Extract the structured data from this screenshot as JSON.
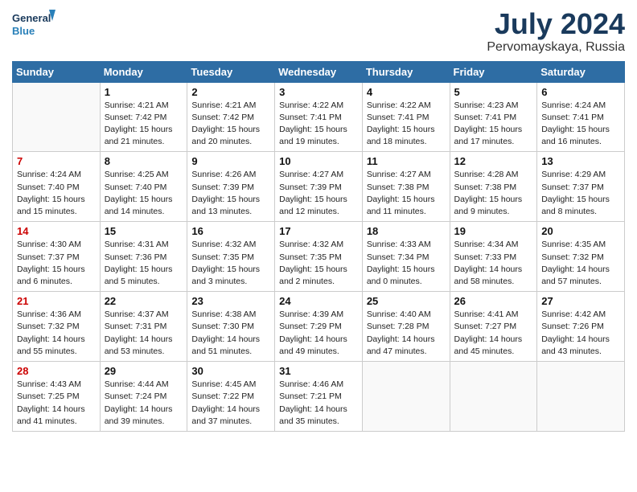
{
  "header": {
    "logo_line1": "General",
    "logo_line2": "Blue",
    "month_year": "July 2024",
    "location": "Pervomayskaya, Russia"
  },
  "days_of_week": [
    "Sunday",
    "Monday",
    "Tuesday",
    "Wednesday",
    "Thursday",
    "Friday",
    "Saturday"
  ],
  "weeks": [
    [
      {
        "day": "",
        "info": ""
      },
      {
        "day": "1",
        "info": "Sunrise: 4:21 AM\nSunset: 7:42 PM\nDaylight: 15 hours\nand 21 minutes."
      },
      {
        "day": "2",
        "info": "Sunrise: 4:21 AM\nSunset: 7:42 PM\nDaylight: 15 hours\nand 20 minutes."
      },
      {
        "day": "3",
        "info": "Sunrise: 4:22 AM\nSunset: 7:41 PM\nDaylight: 15 hours\nand 19 minutes."
      },
      {
        "day": "4",
        "info": "Sunrise: 4:22 AM\nSunset: 7:41 PM\nDaylight: 15 hours\nand 18 minutes."
      },
      {
        "day": "5",
        "info": "Sunrise: 4:23 AM\nSunset: 7:41 PM\nDaylight: 15 hours\nand 17 minutes."
      },
      {
        "day": "6",
        "info": "Sunrise: 4:24 AM\nSunset: 7:41 PM\nDaylight: 15 hours\nand 16 minutes."
      }
    ],
    [
      {
        "day": "7",
        "info": "Sunrise: 4:24 AM\nSunset: 7:40 PM\nDaylight: 15 hours\nand 15 minutes."
      },
      {
        "day": "8",
        "info": "Sunrise: 4:25 AM\nSunset: 7:40 PM\nDaylight: 15 hours\nand 14 minutes."
      },
      {
        "day": "9",
        "info": "Sunrise: 4:26 AM\nSunset: 7:39 PM\nDaylight: 15 hours\nand 13 minutes."
      },
      {
        "day": "10",
        "info": "Sunrise: 4:27 AM\nSunset: 7:39 PM\nDaylight: 15 hours\nand 12 minutes."
      },
      {
        "day": "11",
        "info": "Sunrise: 4:27 AM\nSunset: 7:38 PM\nDaylight: 15 hours\nand 11 minutes."
      },
      {
        "day": "12",
        "info": "Sunrise: 4:28 AM\nSunset: 7:38 PM\nDaylight: 15 hours\nand 9 minutes."
      },
      {
        "day": "13",
        "info": "Sunrise: 4:29 AM\nSunset: 7:37 PM\nDaylight: 15 hours\nand 8 minutes."
      }
    ],
    [
      {
        "day": "14",
        "info": "Sunrise: 4:30 AM\nSunset: 7:37 PM\nDaylight: 15 hours\nand 6 minutes."
      },
      {
        "day": "15",
        "info": "Sunrise: 4:31 AM\nSunset: 7:36 PM\nDaylight: 15 hours\nand 5 minutes."
      },
      {
        "day": "16",
        "info": "Sunrise: 4:32 AM\nSunset: 7:35 PM\nDaylight: 15 hours\nand 3 minutes."
      },
      {
        "day": "17",
        "info": "Sunrise: 4:32 AM\nSunset: 7:35 PM\nDaylight: 15 hours\nand 2 minutes."
      },
      {
        "day": "18",
        "info": "Sunrise: 4:33 AM\nSunset: 7:34 PM\nDaylight: 15 hours\nand 0 minutes."
      },
      {
        "day": "19",
        "info": "Sunrise: 4:34 AM\nSunset: 7:33 PM\nDaylight: 14 hours\nand 58 minutes."
      },
      {
        "day": "20",
        "info": "Sunrise: 4:35 AM\nSunset: 7:32 PM\nDaylight: 14 hours\nand 57 minutes."
      }
    ],
    [
      {
        "day": "21",
        "info": "Sunrise: 4:36 AM\nSunset: 7:32 PM\nDaylight: 14 hours\nand 55 minutes."
      },
      {
        "day": "22",
        "info": "Sunrise: 4:37 AM\nSunset: 7:31 PM\nDaylight: 14 hours\nand 53 minutes."
      },
      {
        "day": "23",
        "info": "Sunrise: 4:38 AM\nSunset: 7:30 PM\nDaylight: 14 hours\nand 51 minutes."
      },
      {
        "day": "24",
        "info": "Sunrise: 4:39 AM\nSunset: 7:29 PM\nDaylight: 14 hours\nand 49 minutes."
      },
      {
        "day": "25",
        "info": "Sunrise: 4:40 AM\nSunset: 7:28 PM\nDaylight: 14 hours\nand 47 minutes."
      },
      {
        "day": "26",
        "info": "Sunrise: 4:41 AM\nSunset: 7:27 PM\nDaylight: 14 hours\nand 45 minutes."
      },
      {
        "day": "27",
        "info": "Sunrise: 4:42 AM\nSunset: 7:26 PM\nDaylight: 14 hours\nand 43 minutes."
      }
    ],
    [
      {
        "day": "28",
        "info": "Sunrise: 4:43 AM\nSunset: 7:25 PM\nDaylight: 14 hours\nand 41 minutes."
      },
      {
        "day": "29",
        "info": "Sunrise: 4:44 AM\nSunset: 7:24 PM\nDaylight: 14 hours\nand 39 minutes."
      },
      {
        "day": "30",
        "info": "Sunrise: 4:45 AM\nSunset: 7:22 PM\nDaylight: 14 hours\nand 37 minutes."
      },
      {
        "day": "31",
        "info": "Sunrise: 4:46 AM\nSunset: 7:21 PM\nDaylight: 14 hours\nand 35 minutes."
      },
      {
        "day": "",
        "info": ""
      },
      {
        "day": "",
        "info": ""
      },
      {
        "day": "",
        "info": ""
      }
    ]
  ]
}
